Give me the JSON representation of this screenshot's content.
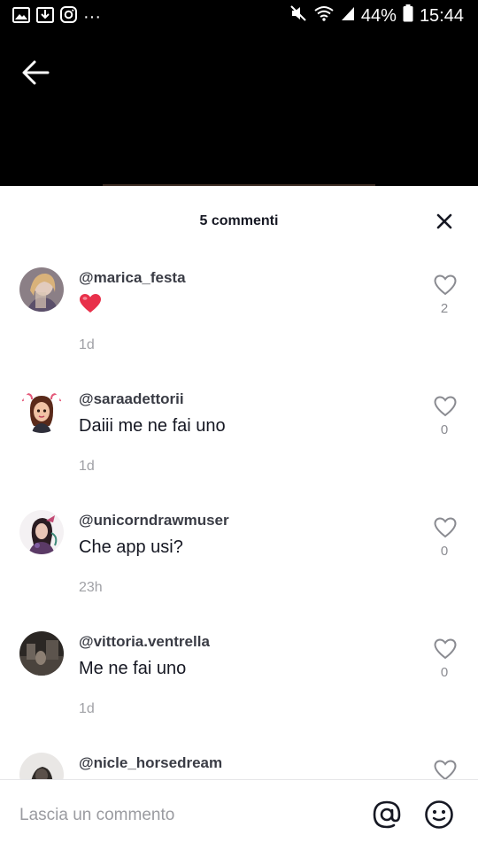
{
  "status_bar": {
    "battery_percent": "44%",
    "time": "15:44",
    "more_dots": "···"
  },
  "header": {
    "title": "5 commenti"
  },
  "comments": [
    {
      "username": "@marica_festa",
      "text": "",
      "emoji": "red-heart-emoji",
      "time": "1d",
      "likes": "2"
    },
    {
      "username": "@saraadettorii",
      "text": "Daiii me ne fai uno",
      "time": "1d",
      "likes": "0"
    },
    {
      "username": "@unicorndrawmuser",
      "text": "Che app usi?",
      "time": "23h",
      "likes": "0"
    },
    {
      "username": "@vittoria.ventrella",
      "text": "Me ne fai uno",
      "time": "1d",
      "likes": "0"
    },
    {
      "username": "@nicle_horsedream",
      "text": "",
      "time": "",
      "likes": ""
    }
  ],
  "input": {
    "placeholder": "Lascia un commento",
    "value": ""
  },
  "colors": {
    "heart": "#e8304a",
    "text_primary": "#161823",
    "text_secondary": "#a0a1a6"
  }
}
